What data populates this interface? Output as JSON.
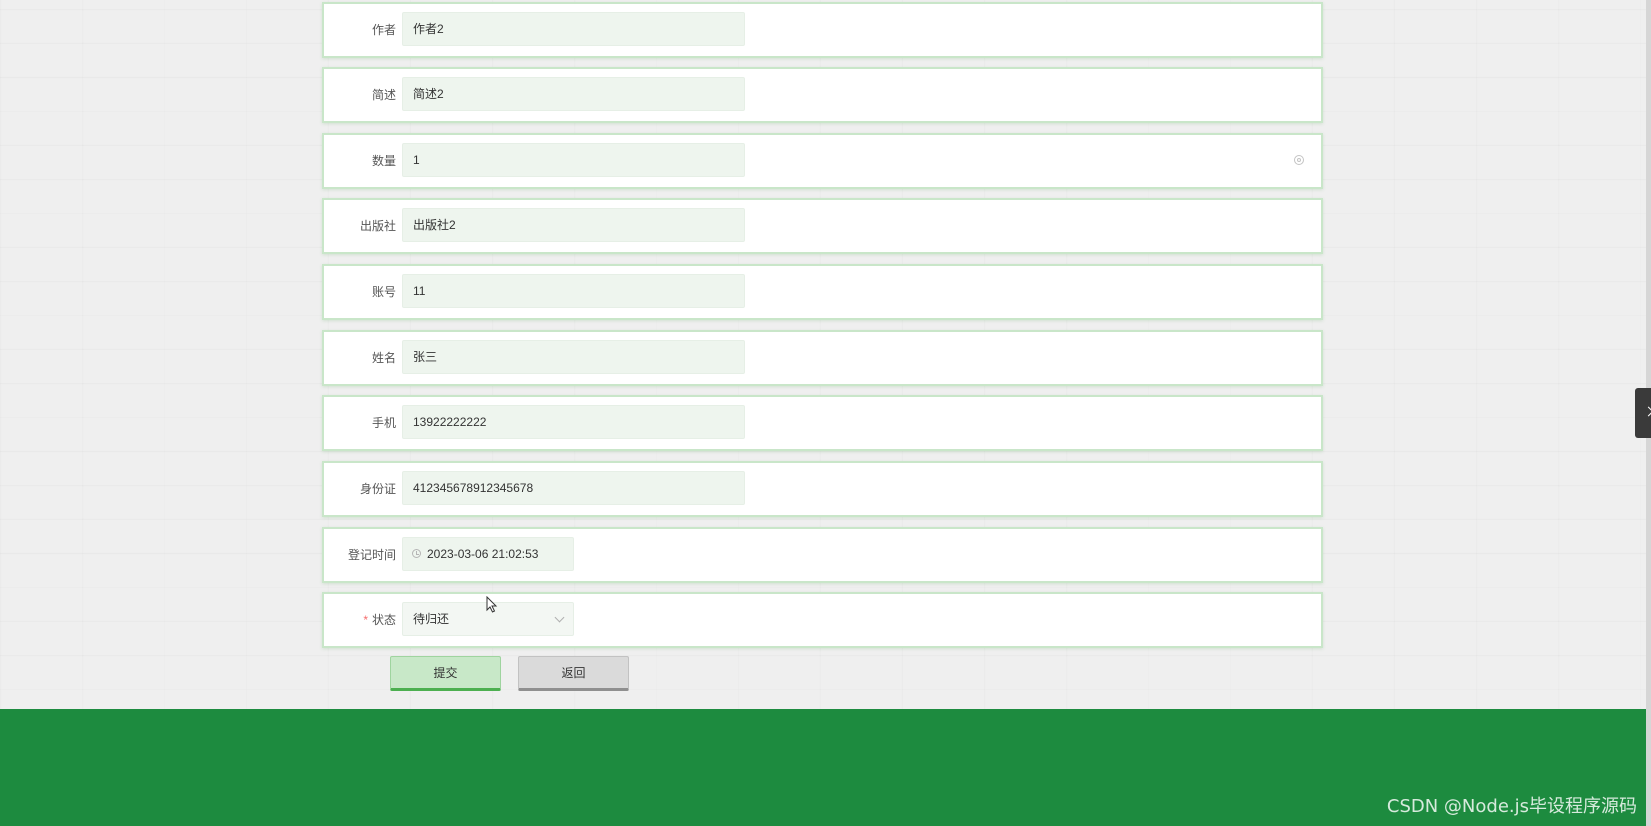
{
  "form": {
    "fields": [
      {
        "label": "作者",
        "value": "作者2"
      },
      {
        "label": "简述",
        "value": "简述2"
      },
      {
        "label": "数量",
        "value": "1"
      },
      {
        "label": "出版社",
        "value": "出版社2"
      },
      {
        "label": "账号",
        "value": "11"
      },
      {
        "label": "姓名",
        "value": "张三"
      },
      {
        "label": "手机",
        "value": "13922222222"
      },
      {
        "label": "身份证",
        "value": "412345678912345678"
      },
      {
        "label": "登记时间",
        "value": "2023-03-06 21:02:53"
      },
      {
        "label": "状态",
        "value": "待归还",
        "required": "*"
      }
    ],
    "submit_label": "提交",
    "back_label": "返回"
  },
  "watermark": "CSDN @Node.js毕设程序源码",
  "colors": {
    "footer": "#1d8b3f",
    "field_border": "#c9e6c9",
    "submit": "#c8e8c8",
    "back": "#dadada"
  },
  "icons": {
    "quantity": "stepper-icon",
    "date": "clock-icon",
    "status": "chevron-down-icon",
    "side": "chevron-right-icon"
  }
}
